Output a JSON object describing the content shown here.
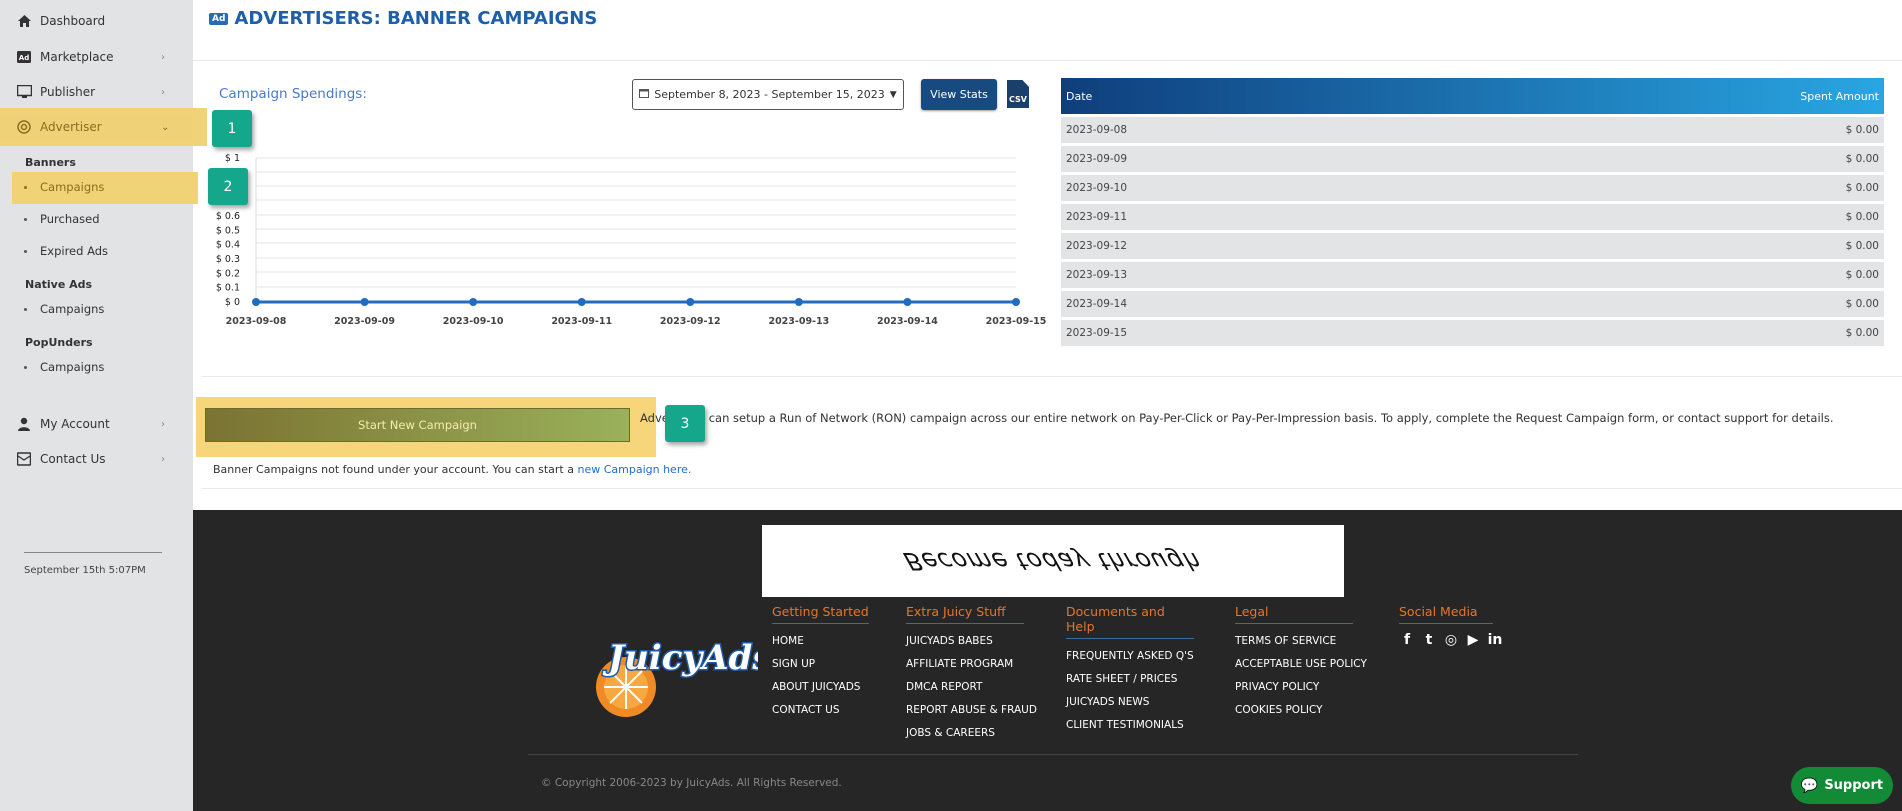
{
  "sidebar": {
    "items": [
      {
        "label": "Dashboard",
        "icon": "home-icon",
        "chevron": ""
      },
      {
        "label": "Marketplace",
        "icon": "ad-icon",
        "chevron": "›"
      },
      {
        "label": "Publisher",
        "icon": "monitor-icon",
        "chevron": "›"
      },
      {
        "label": "Advertiser",
        "icon": "target-icon",
        "chevron": "⌄"
      }
    ],
    "groups": [
      {
        "title": "Banners",
        "items": [
          "Campaigns",
          "Purchased",
          "Expired Ads"
        ]
      },
      {
        "title": "Native Ads",
        "items": [
          "Campaigns"
        ]
      },
      {
        "title": "PopUnders",
        "items": [
          "Campaigns"
        ]
      }
    ],
    "account": {
      "my_account": "My Account",
      "contact_us": "Contact Us",
      "chevron": "›"
    },
    "timestamp": "September 15th 5:07PM"
  },
  "page": {
    "badge": "Ad",
    "title": "ADVERTISERS: BANNER CAMPAIGNS"
  },
  "spend": {
    "title": "Campaign Spendings:",
    "date_range": "September 8, 2023 - September 15, 2023",
    "view_stats": "View Stats",
    "csv": "CSV"
  },
  "chart_data": {
    "type": "line",
    "x": [
      "2023-09-08",
      "2023-09-09",
      "2023-09-10",
      "2023-09-11",
      "2023-09-12",
      "2023-09-13",
      "2023-09-14",
      "2023-09-15"
    ],
    "series": [
      {
        "values": [
          0,
          0,
          0,
          0,
          0,
          0,
          0,
          0
        ]
      }
    ],
    "yticks": [
      "$ 0",
      "$ 0.1",
      "$ 0.2",
      "$ 0.3",
      "$ 0.4",
      "$ 0.5",
      "$ 0.6",
      "$ 1"
    ],
    "ylim": [
      0,
      1
    ],
    "grid": true,
    "color": "#1f6cc0"
  },
  "table": {
    "headers": [
      "Date",
      "Spent Amount"
    ],
    "rows": [
      [
        "2023-09-08",
        "$ 0.00"
      ],
      [
        "2023-09-09",
        "$ 0.00"
      ],
      [
        "2023-09-10",
        "$ 0.00"
      ],
      [
        "2023-09-11",
        "$ 0.00"
      ],
      [
        "2023-09-12",
        "$ 0.00"
      ],
      [
        "2023-09-13",
        "$ 0.00"
      ],
      [
        "2023-09-14",
        "$ 0.00"
      ],
      [
        "2023-09-15",
        "$ 0.00"
      ]
    ]
  },
  "campaign": {
    "start_button": "Start New Campaign",
    "ron_text": "Advertisers can setup a Run of Network (RON) campaign across our entire network on Pay-Per-Click or Pay-Per-Impression basis. To apply, complete the Request Campaign form, or contact support for details.",
    "not_found": "Banner Campaigns not found under your account. You can start a",
    "not_found_link": "new Campaign here."
  },
  "steps": [
    "1",
    "2",
    "3"
  ],
  "footer": {
    "banner_text": "Become today through",
    "columns": [
      {
        "title": "Getting Started",
        "links": [
          "HOME",
          "SIGN UP",
          "ABOUT JUICYADS",
          "CONTACT US"
        ]
      },
      {
        "title": "Extra Juicy Stuff",
        "links": [
          "JUICYADS BABES",
          "AFFILIATE PROGRAM",
          "DMCA REPORT",
          "REPORT ABUSE & FRAUD",
          "JOBS & CAREERS"
        ]
      },
      {
        "title": "Documents and Help",
        "links": [
          "FREQUENTLY ASKED Q'S",
          "RATE SHEET / PRICES",
          "JUICYADS NEWS",
          "CLIENT TESTIMONIALS"
        ]
      },
      {
        "title": "Legal",
        "links": [
          "TERMS OF SERVICE",
          "ACCEPTABLE USE POLICY",
          "PRIVACY POLICY",
          "COOKIES POLICY"
        ]
      },
      {
        "title": "Social Media",
        "links": []
      }
    ],
    "social": [
      "f",
      "t",
      "◎",
      "▶",
      "in"
    ],
    "copyright": "© Copyright 2006-2023 by JuicyAds. All Rights Reserved.",
    "logo_text": "JuicyAds",
    "support": "Support"
  }
}
